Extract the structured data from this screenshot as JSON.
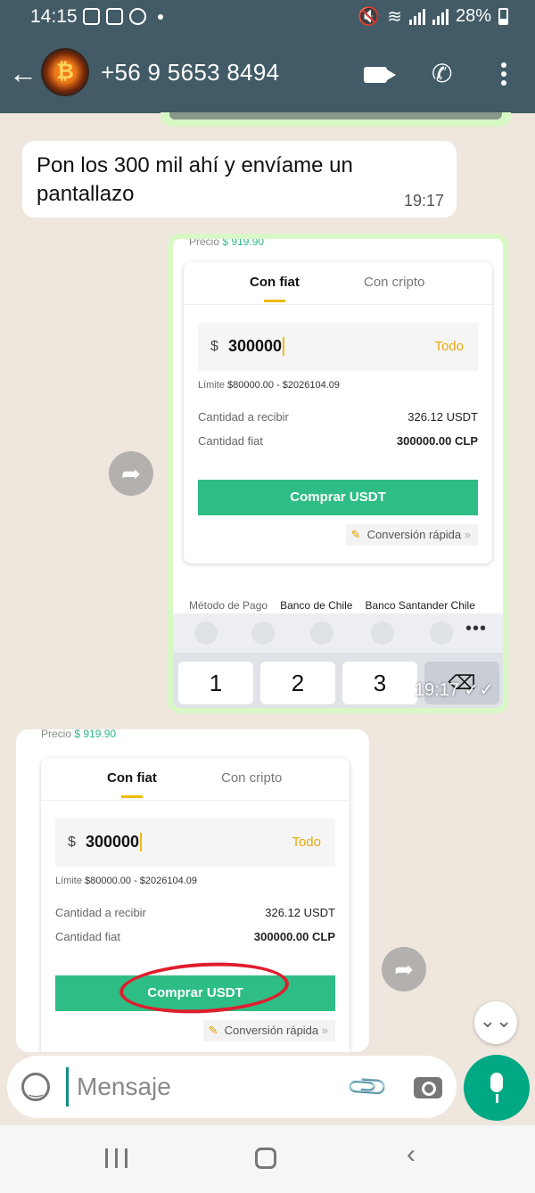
{
  "status": {
    "time": "14:15",
    "battery": "28%"
  },
  "header": {
    "back": "←",
    "contact": "+56 9 5653 8494",
    "avatar_letter": "₿"
  },
  "messages": {
    "m1": {
      "text": "Pon los 300 mil ahí y envíame un pantallazo",
      "time": "19:17"
    },
    "img1": {
      "time": "19:17 ✓✓"
    }
  },
  "screenshot": {
    "price_label": "Precio",
    "price_value": "$ 919.90",
    "tab_fiat": "Con fiat",
    "tab_crypto": "Con cripto",
    "currency": "$",
    "amount": "300000",
    "all": "Todo",
    "limit_label": "Límite",
    "limit_value": "$80000.00 - $2026104.09",
    "receive_label": "Cantidad a recibir",
    "receive_value": "326.12 USDT",
    "fiat_label": "Cantidad fiat",
    "fiat_value": "300000.00 CLP",
    "buy_label": "Comprar USDT",
    "quick": "Conversión rápida",
    "pay_label": "Método de Pago",
    "pay1": "Banco de Chile",
    "pay2": "Banco Santander Chile"
  },
  "keyboard": {
    "k1": "1",
    "k2": "2",
    "k3": "3",
    "del": "⌫",
    "more": "•••"
  },
  "input": {
    "placeholder": "Mensaje"
  },
  "icons": {
    "forward": "➦",
    "scroll_down": "⌄⌄",
    "nav_back": "‹"
  }
}
